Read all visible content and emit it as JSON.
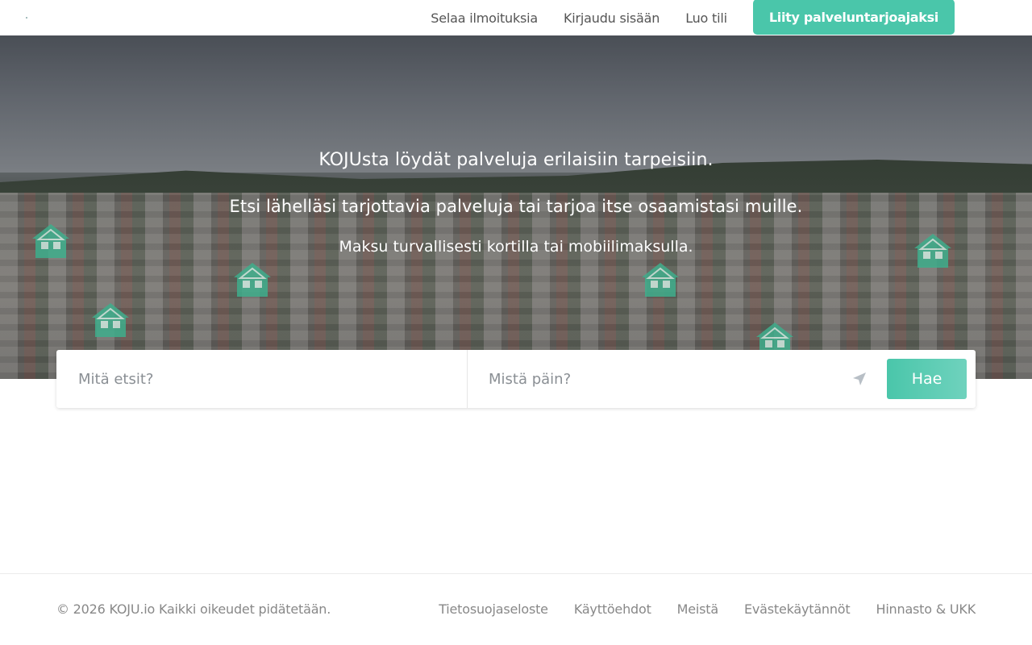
{
  "header": {
    "nav": [
      {
        "label": "Selaa ilmoituksia"
      },
      {
        "label": "Kirjaudu sisään"
      },
      {
        "label": "Luo tili"
      }
    ],
    "cta_label": "Liity palveluntarjoajaksi"
  },
  "hero": {
    "line1": "KOJUsta löydät palveluja erilaisiin tarpeisiin.",
    "line2": "Etsi lähelläsi tarjottavia palveluja tai tarjoa itse osaamistasi muille.",
    "line3": "Maksu turvallisesti kortilla tai mobiilimaksulla."
  },
  "search": {
    "what_placeholder": "Mitä etsit?",
    "what_value": "",
    "where_placeholder": "Mistä päin?",
    "where_value": "",
    "locate_icon": "location-arrow-icon",
    "button_label": "Hae"
  },
  "footer": {
    "copyright": "© 2026 KOJU.io Kaikki oikeudet pidätetään.",
    "links": [
      {
        "label": "Tietosuojaseloste"
      },
      {
        "label": "Käyttöehdot"
      },
      {
        "label": "Meistä"
      },
      {
        "label": "Evästekäytännöt"
      },
      {
        "label": "Hinnasto & UKK"
      }
    ]
  },
  "colors": {
    "accent": "#4ac6aa",
    "house_icon": "#3fae8c"
  }
}
